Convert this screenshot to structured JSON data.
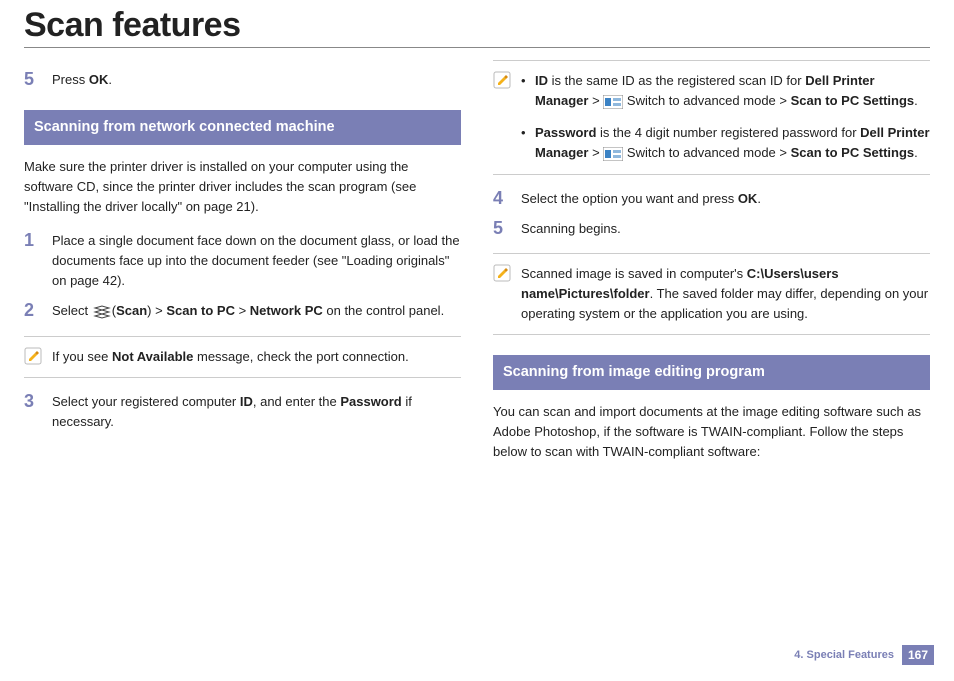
{
  "title": "Scan features",
  "left": {
    "step5_pre": "Press ",
    "step5_b": "OK",
    "step5_post": ".",
    "heading1": "Scanning from network connected machine",
    "intro": "Make sure the printer driver is installed on your computer using the software CD, since the printer driver includes the scan program (see \"Installing the driver locally\" on page 21).",
    "step1": "Place a single document face down on the document glass, or load the documents face up into the document feeder (see \"Loading originals\" on page 42).",
    "s2_select": "Select ",
    "s2_scan": "Scan",
    "s2_gt1": " > ",
    "s2_scan_pc": "Scan to PC",
    "s2_gt2": " > ",
    "s2_net_pc": "Network PC",
    "s2_tail": " on the control panel.",
    "note1_pre": "If you see ",
    "note1_b": "Not Available",
    "note1_post": " message, check the port connection.",
    "s3_pre": "Select your registered computer ",
    "s3_id": "ID",
    "s3_mid": ", and enter the ",
    "s3_pw": "Password",
    "s3_post": " if necessary."
  },
  "right": {
    "n2_id_b": "ID",
    "n2_id_mid": " is the same ID as the registered scan ID for ",
    "n2_dpm": "Dell Printer Manager",
    "n2_gt": " > ",
    "n2_swadv": " Switch to advanced mode ",
    "n2_scanpc": "Scan to PC Settings",
    "n2_dot": ".",
    "n2_pw_b": "Password",
    "n2_pw_mid": " is the 4 digit number registered password for ",
    "s4_pre": "Select the option you want and press ",
    "s4_ok": "OK",
    "s4_post": ".",
    "s5": "Scanning begins.",
    "n3_pre": "Scanned image is saved in computer's ",
    "n3_path": "C:\\Users\\users name\\Pictures\\folder",
    "n3_post": ". The saved folder may differ, depending on your operating system or the application you are using.",
    "heading2": "Scanning from image editing program",
    "intro2": "You can scan and import documents at the image editing software such as Adobe Photoshop, if the software is TWAIN-compliant. Follow the steps below to scan with TWAIN-compliant software:"
  },
  "footer": {
    "chapter": "4.  Special Features",
    "page": "167"
  },
  "icons": {
    "pencil": "pencil-note-icon",
    "scan": "scan-icon",
    "advanced": "advanced-mode-icon"
  }
}
